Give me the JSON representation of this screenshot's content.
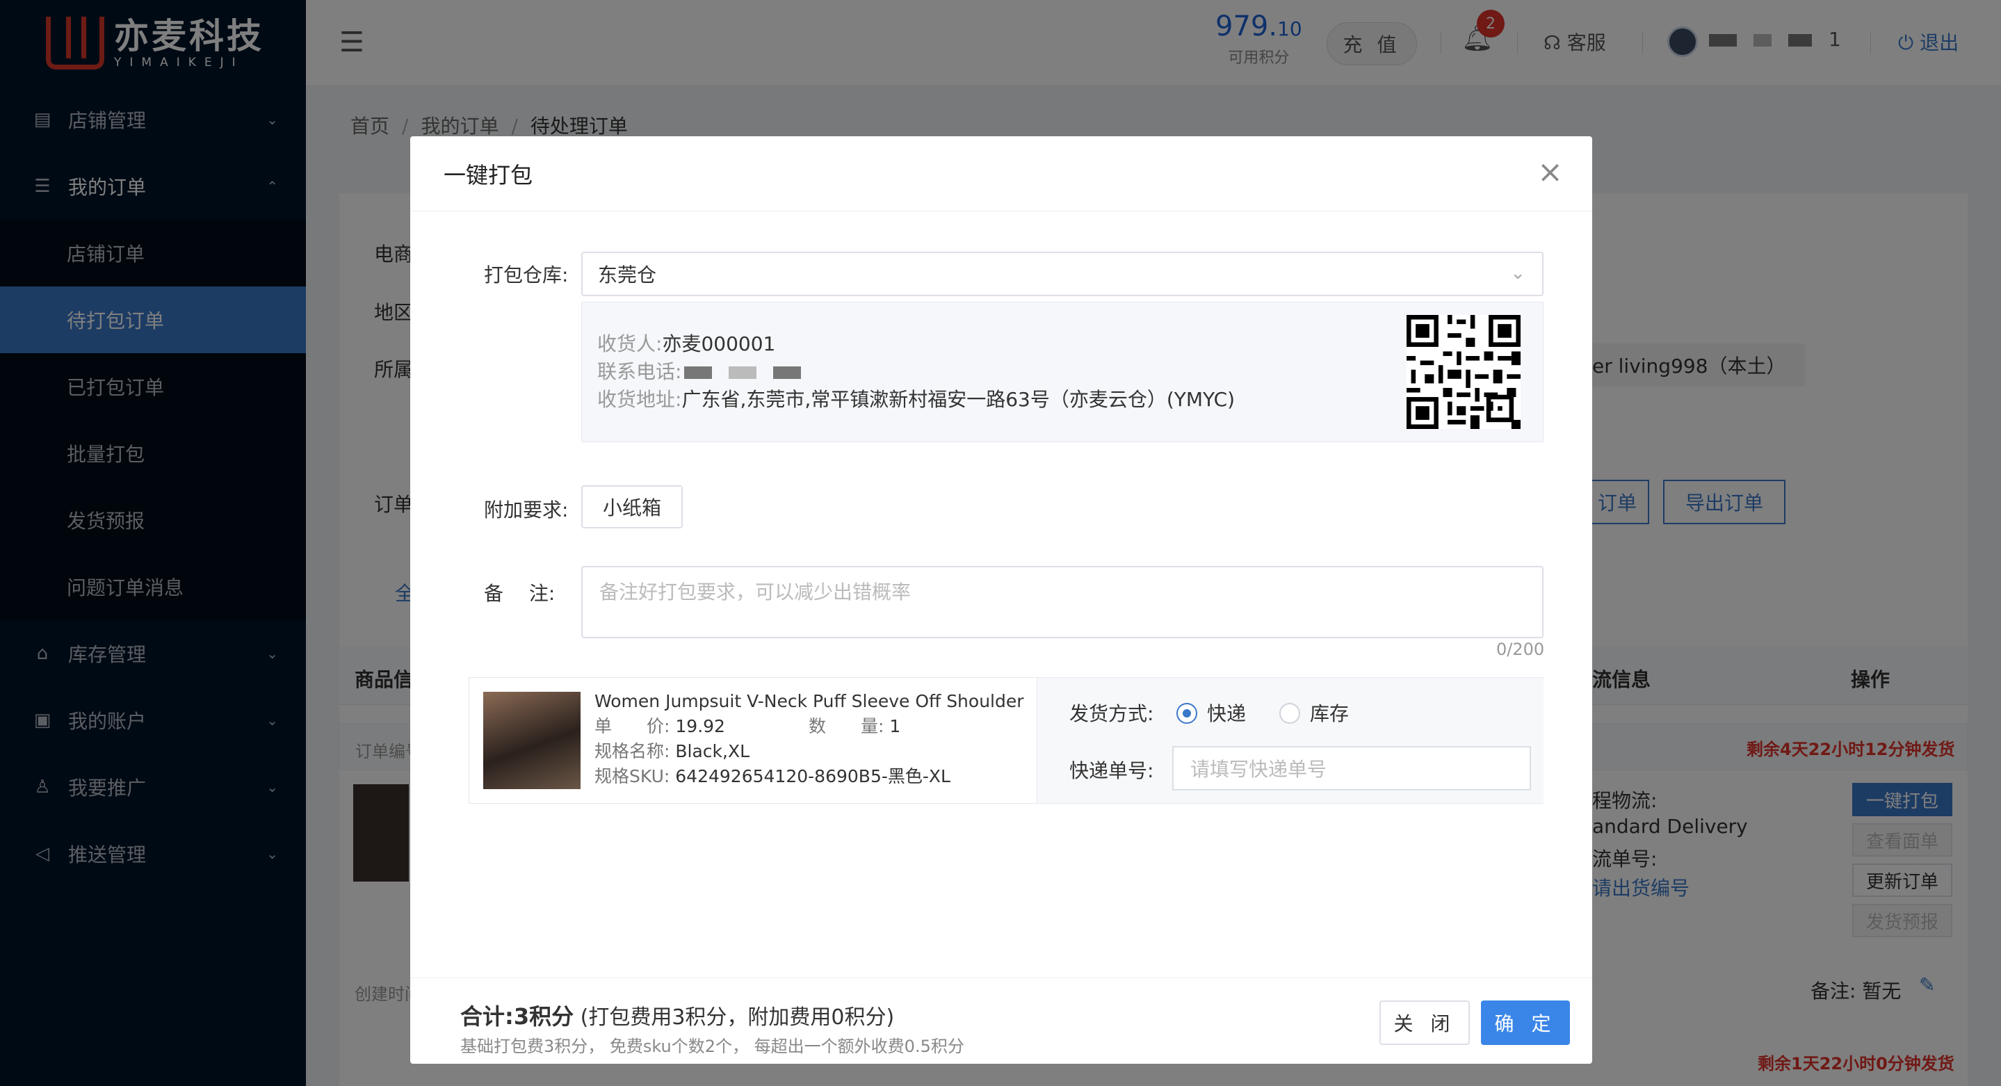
{
  "brand": {
    "name_cn": "亦麦科技",
    "name_en": "YIMAIKEJI",
    "accent": "#d8382b"
  },
  "sidebar": {
    "items": [
      {
        "label": "店铺管理",
        "icon": "store-icon"
      },
      {
        "label": "我的订单",
        "icon": "orders-icon"
      },
      {
        "label": "库存管理",
        "icon": "warehouse-icon"
      },
      {
        "label": "我的账户",
        "icon": "account-icon"
      },
      {
        "label": "我要推广",
        "icon": "promote-icon"
      },
      {
        "label": "推送管理",
        "icon": "push-icon"
      }
    ],
    "orders_submenu": [
      "店铺订单",
      "待打包订单",
      "已打包订单",
      "批量打包",
      "发货预报",
      "问题订单消息"
    ],
    "active": "待打包订单"
  },
  "header": {
    "points_int": "979.",
    "points_dec": "10",
    "points_label": "可用积分",
    "recharge": "充 值",
    "notifications": "2",
    "service": "客服",
    "username_suffix": "1",
    "logout": "退出"
  },
  "breadcrumb": [
    "首页",
    "我的订单",
    "待处理订单"
  ],
  "background": {
    "labels": [
      "电商",
      "地区",
      "所属",
      "订单"
    ],
    "tab_partial": "全",
    "store_tag": "er living998（本土）",
    "btn_partial": "订单",
    "btn_export": "导出订单",
    "col_product": "商品信",
    "col_logistics": "流信息",
    "col_action": "操作",
    "order_no_label": "订单编号",
    "countdown1": "剩余4天22小时12分钟发货",
    "countdown2": "剩余1天22小时0分钟发货",
    "logistics1": "程物流:",
    "logistics2": "andard Delivery",
    "logistics3": "流单号:",
    "logistics4": "请出货编号",
    "created": "创建时间",
    "remark": "备注: 暂无",
    "actions": [
      "一键打包",
      "查看面单",
      "更新订单",
      "发货预报"
    ]
  },
  "modal": {
    "title": "一键打包",
    "warehouse_label": "打包仓库:",
    "warehouse_value": "东莞仓",
    "receiver_label": "收货人:",
    "receiver_value": "亦麦000001",
    "phone_label": "联系电话:",
    "address_label": "收货地址:",
    "address_value": "广东省,东莞市,常平镇漱新村福安一路63号（亦麦云仓）(YMYC)",
    "extra_label": "附加要求:",
    "extra_option": "小纸箱",
    "remark_label": "备　 注:",
    "remark_placeholder": "备注好打包要求，可以减少出错概率",
    "remark_counter": "0/200",
    "product": {
      "title": "Women Jumpsuit V-Neck Puff Sleeve Off Shoulder S...",
      "price_label": "单　　价:",
      "price": "19.92",
      "qty_label": "数　　量:",
      "qty": "1",
      "spec_label": "规格名称:",
      "spec": "Black,XL",
      "sku_label": "规格SKU:",
      "sku": "642492654120-8690B5-黑色-XL"
    },
    "ship_method_label": "发货方式:",
    "ship_options": [
      "快递",
      "库存"
    ],
    "ship_selected": "快递",
    "tracking_label": "快递单号:",
    "tracking_placeholder": "请填写快递单号",
    "total_prefix": "合计:",
    "total_value": "3积分",
    "total_detail": "(打包费用3积分，附加费用0积分)",
    "total_note": "基础打包费3积分， 免费sku个数2个， 每超出一个额外收费0.5积分",
    "btn_close": "关 闭",
    "btn_confirm": "确 定"
  }
}
